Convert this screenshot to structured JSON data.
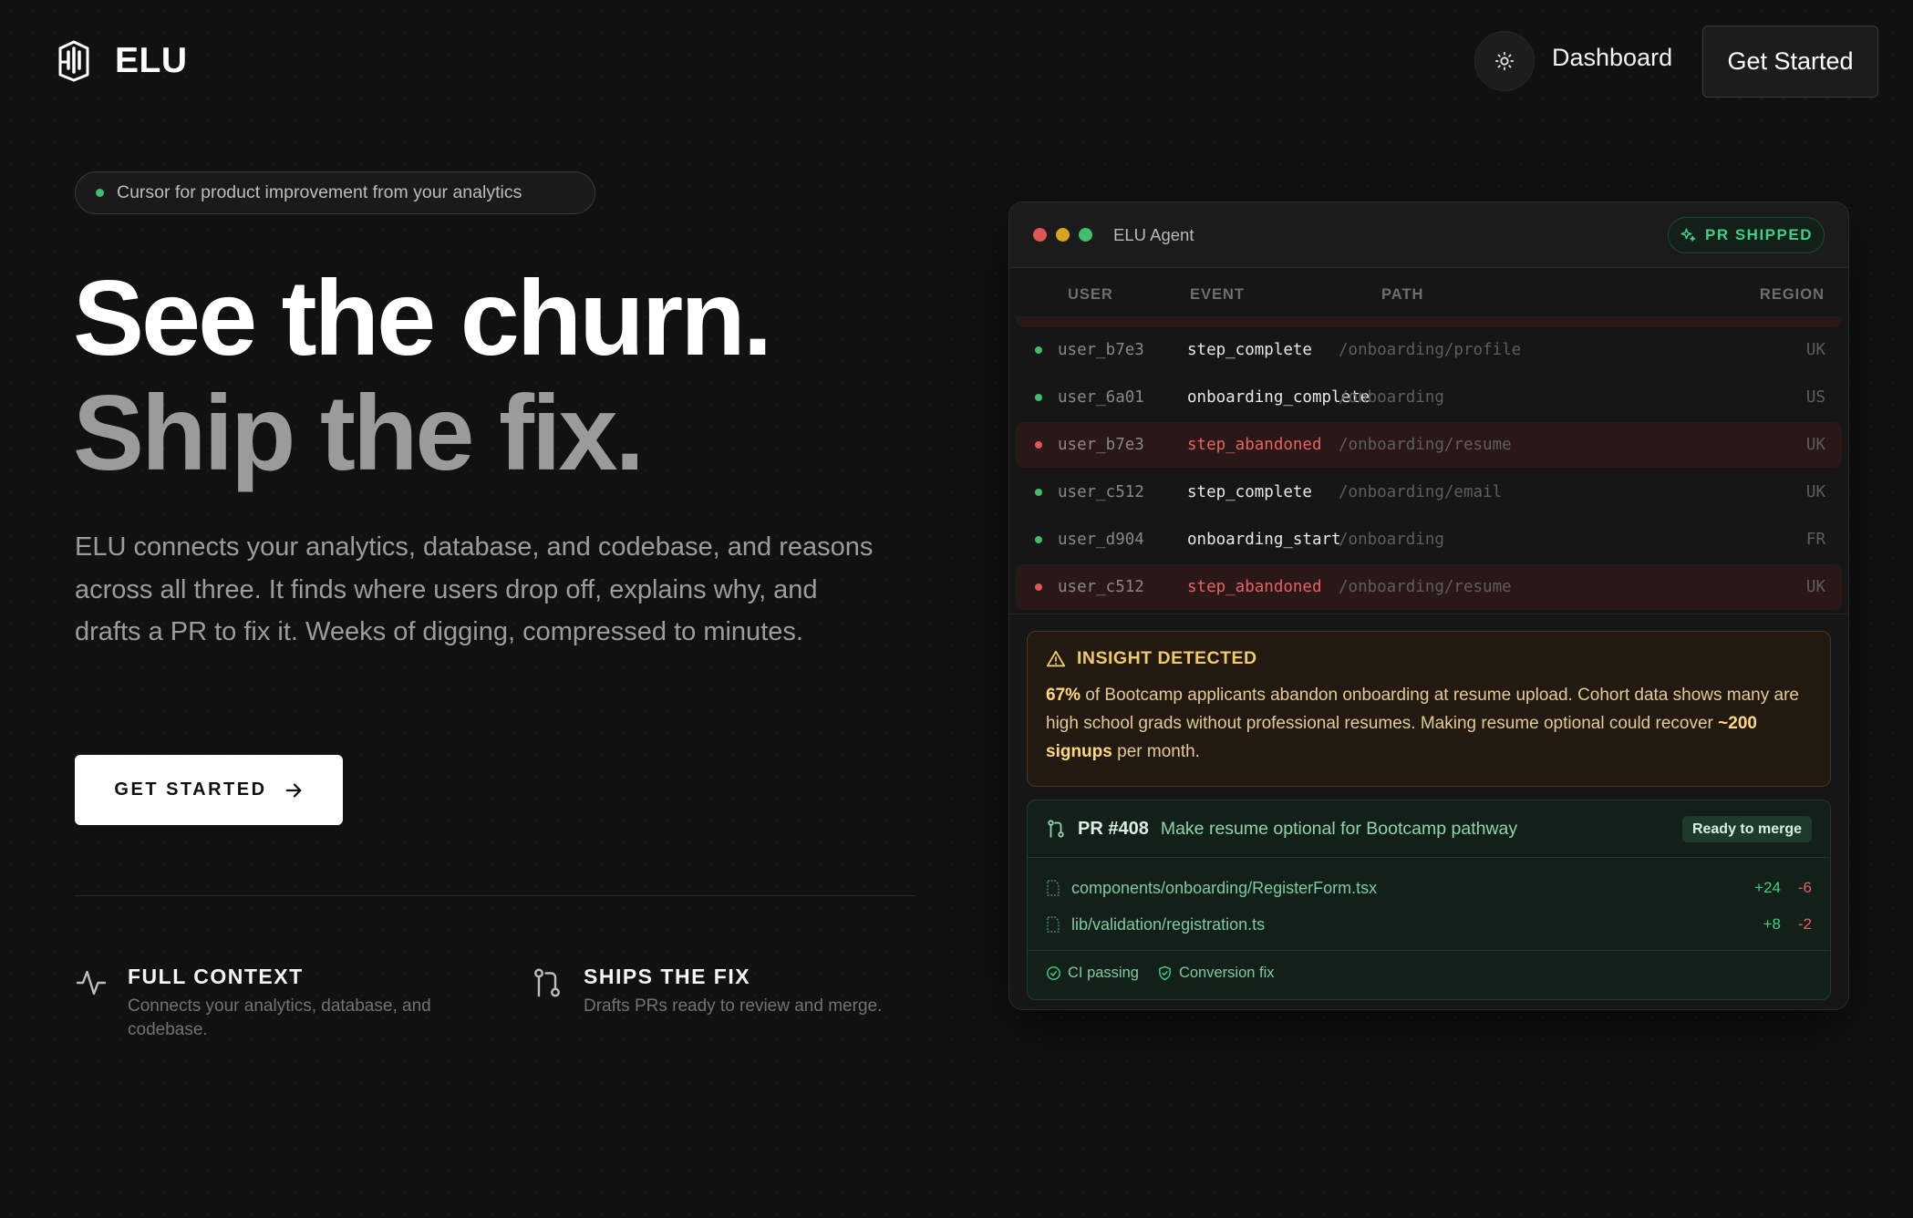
{
  "brand": {
    "name": "ELU"
  },
  "nav": {
    "theme_icon": "sun-icon",
    "dashboard_label": "Dashboard",
    "get_started_label": "Get Started"
  },
  "hero": {
    "badge": "Cursor for product improvement from your analytics",
    "headline_1": "See the churn.",
    "headline_2": "Ship the fix.",
    "subtext": "ELU connects your analytics, database, and codebase, and reasons across all three. It finds where users drop off, explains why, and drafts a PR to fix it. Weeks of digging, compressed to minutes.",
    "cta_label": "GET STARTED"
  },
  "features": [
    {
      "icon": "activity-icon",
      "title": "FULL CONTEXT",
      "desc": "Connects your analytics, database, and codebase."
    },
    {
      "icon": "git-pull-request-icon",
      "title": "SHIPS THE FIX",
      "desc": "Drafts PRs ready to review and merge."
    }
  ],
  "agent": {
    "title": "ELU Agent",
    "status": "PR SHIPPED",
    "columns": [
      "USER",
      "EVENT",
      "PATH",
      "REGION"
    ],
    "rows": [
      {
        "user": "user_b7e3",
        "event": "step_complete",
        "path": "/onboarding/profile",
        "region": "UK",
        "alert": false
      },
      {
        "user": "user_6a01",
        "event": "onboarding_complete",
        "path": "/onboarding",
        "region": "US",
        "alert": false
      },
      {
        "user": "user_b7e3",
        "event": "step_abandoned",
        "path": "/onboarding/resume",
        "region": "UK",
        "alert": true
      },
      {
        "user": "user_c512",
        "event": "step_complete",
        "path": "/onboarding/email",
        "region": "UK",
        "alert": false
      },
      {
        "user": "user_d904",
        "event": "onboarding_start",
        "path": "/onboarding",
        "region": "FR",
        "alert": false
      },
      {
        "user": "user_c512",
        "event": "step_abandoned",
        "path": "/onboarding/resume",
        "region": "UK",
        "alert": true
      }
    ],
    "insight": {
      "title": "INSIGHT DETECTED",
      "stat": "67%",
      "text_1": " of Bootcamp applicants abandon onboarding at resume upload. Cohort data shows many are high school grads without professional resumes. Making resume optional could recover ",
      "highlight": "~200 signups",
      "text_2": " per month."
    },
    "pr": {
      "number": "PR #408",
      "title": "Make resume optional for Bootcamp pathway",
      "status": "Ready to merge",
      "files": [
        {
          "path": "components/onboarding/RegisterForm.tsx",
          "adds": "+24",
          "dels": "-6"
        },
        {
          "path": "lib/validation/registration.ts",
          "adds": "+8",
          "dels": "-2"
        }
      ],
      "checks": [
        "CI passing",
        "Conversion fix"
      ]
    }
  },
  "colors": {
    "background": "#111111",
    "accent_green": "#3dcf83",
    "alert_red": "#e86262",
    "insight_amber": "#f0c96a",
    "dot_red": "#e05555",
    "dot_yellow": "#d9a520",
    "dot_green": "#3fbf6c"
  }
}
